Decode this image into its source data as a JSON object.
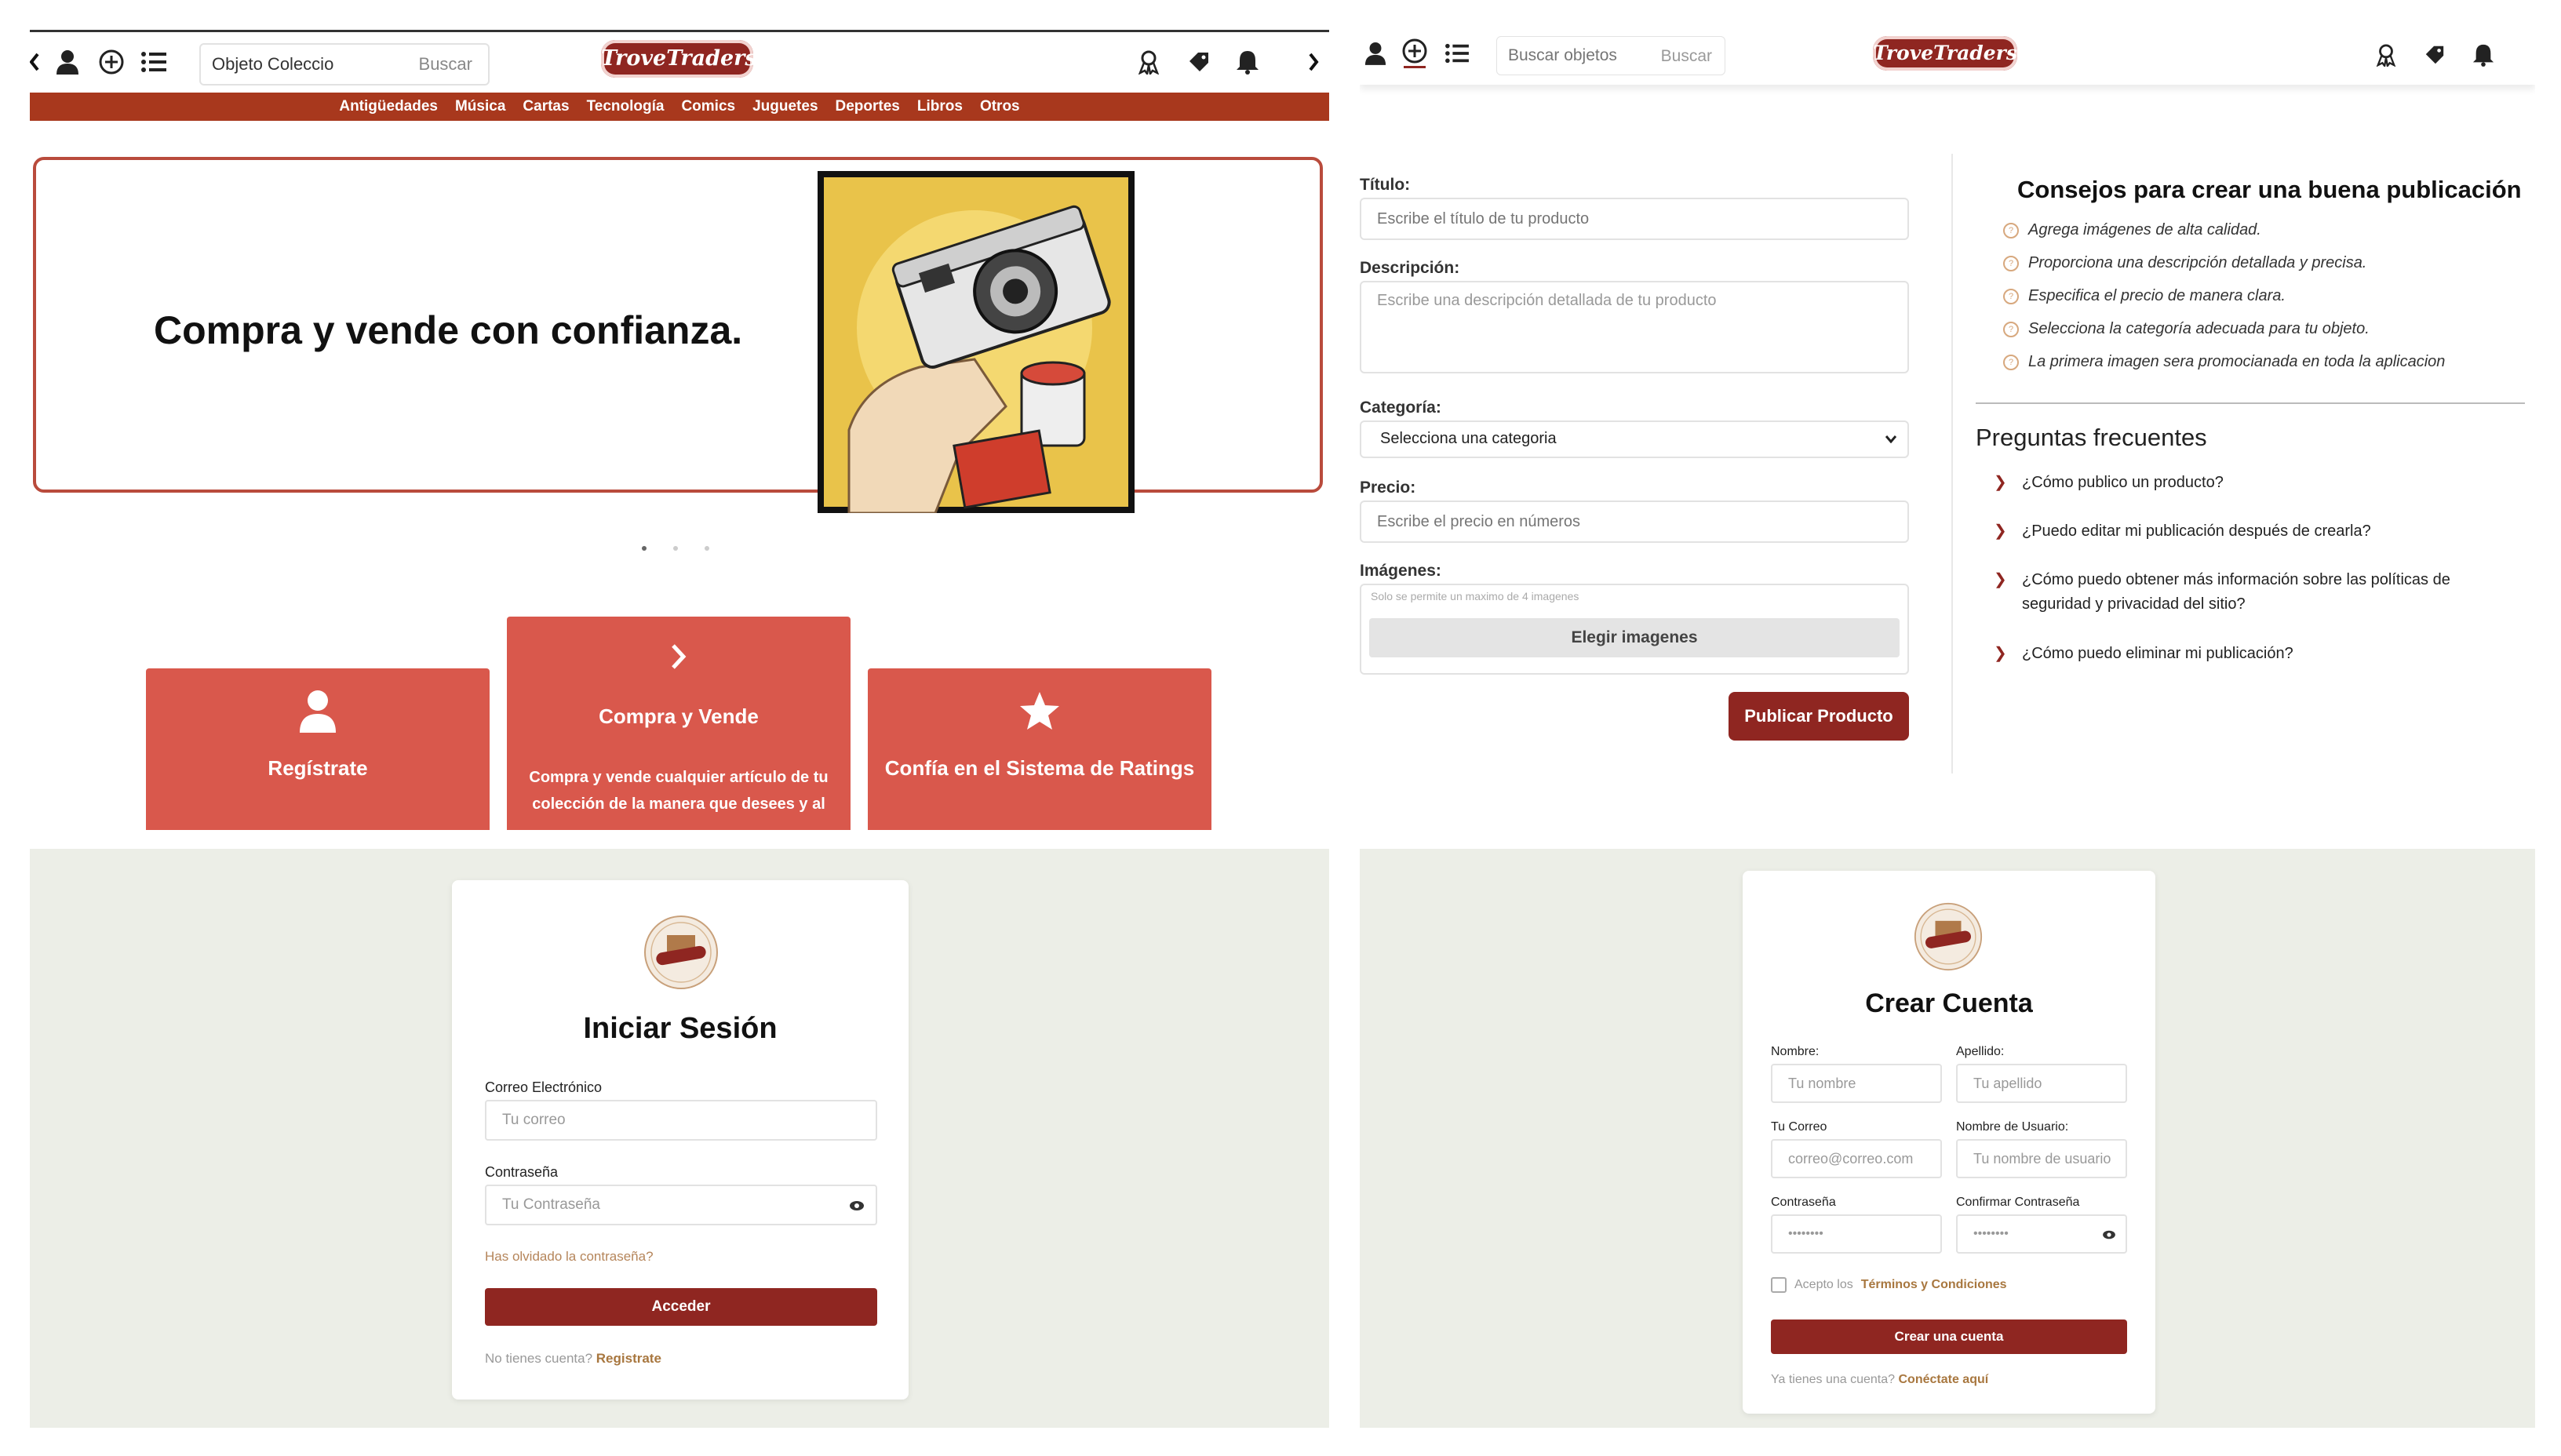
{
  "brand": {
    "logo_text": "TroveTraders"
  },
  "home": {
    "search": {
      "value": "Objeto Coleccio",
      "button": "Buscar"
    },
    "categories": [
      "Antigüedades",
      "Música",
      "Cartas",
      "Tecnología",
      "Comics",
      "Juguetes",
      "Deportes",
      "Libros",
      "Otros"
    ],
    "hero": {
      "headline": "Compra y vende con confianza."
    },
    "carousel": {
      "slides": 3,
      "active": 0
    },
    "features": [
      {
        "title": "Regístrate",
        "icon": "user-icon",
        "desc": ""
      },
      {
        "title": "Compra y Vende",
        "icon": "chevron-right-icon",
        "desc": "Compra y vende cualquier artículo de tu colección de la manera que desees y al"
      },
      {
        "title": "Confía en el Sistema de Ratings",
        "icon": "star-icon",
        "desc": ""
      }
    ]
  },
  "publish": {
    "search": {
      "placeholder": "Buscar objetos",
      "button": "Buscar"
    },
    "form": {
      "title_label": "Título:",
      "title_placeholder": "Escribe el título de tu producto",
      "desc_label": "Descripción:",
      "desc_placeholder": "Escribe una descripción detallada de tu producto",
      "category_label": "Categoría:",
      "category_value": "Selecciona una categoria",
      "price_label": "Precio:",
      "price_placeholder": "Escribe el precio en números",
      "images_label": "Imágenes:",
      "images_hint": "Solo se permite un maximo de 4 imagenes",
      "images_button": "Elegir imagenes",
      "submit": "Publicar Producto"
    },
    "tips": {
      "title": "Consejos para crear una buena publicación",
      "items": [
        "Agrega imágenes de alta calidad.",
        "Proporciona una descripción detallada y precisa.",
        "Especifica el precio de manera clara.",
        "Selecciona la categoría adecuada para tu objeto.",
        "La primera imagen sera promocianada en toda la aplicacion"
      ]
    },
    "faq": {
      "title": "Preguntas frecuentes",
      "items": [
        "¿Cómo publico un producto?",
        "¿Puedo editar mi publicación después de crearla?",
        "¿Cómo puedo obtener más información sobre las políticas de seguridad y privacidad del sitio?",
        "¿Cómo puedo eliminar mi publicación?"
      ]
    }
  },
  "login": {
    "title": "Iniciar Sesión",
    "email_label": "Correo Electrónico",
    "email_placeholder": "Tu correo",
    "password_label": "Contraseña",
    "password_placeholder": "Tu Contraseña",
    "forgot": "Has olvidado la contraseña?",
    "submit": "Acceder",
    "no_account": "No tienes cuenta?",
    "register_link": "Registrate"
  },
  "signup": {
    "title": "Crear Cuenta",
    "first_label": "Nombre:",
    "first_placeholder": "Tu nombre",
    "last_label": "Apellido:",
    "last_placeholder": "Tu apellido",
    "email_label": "Tu Correo",
    "email_placeholder": "correo@correo.com",
    "user_label": "Nombre de Usuario:",
    "user_placeholder": "Tu nombre de usuario",
    "pass_label": "Contraseña",
    "pass_value": "••••••••",
    "confirm_label": "Confirmar Contraseña",
    "confirm_value": "••••••••",
    "accept_text": "Acepto los",
    "terms_link": "Términos y Condiciones",
    "submit": "Crear una cuenta",
    "have_account": "Ya tienes una cuenta?",
    "login_link": "Conéctate aquí"
  },
  "colors": {
    "brand": "#8f2621",
    "category_bar": "#a8381d",
    "feature": "#d9584c",
    "accent_link": "#a8773f",
    "page_bg": "#eceee7"
  }
}
